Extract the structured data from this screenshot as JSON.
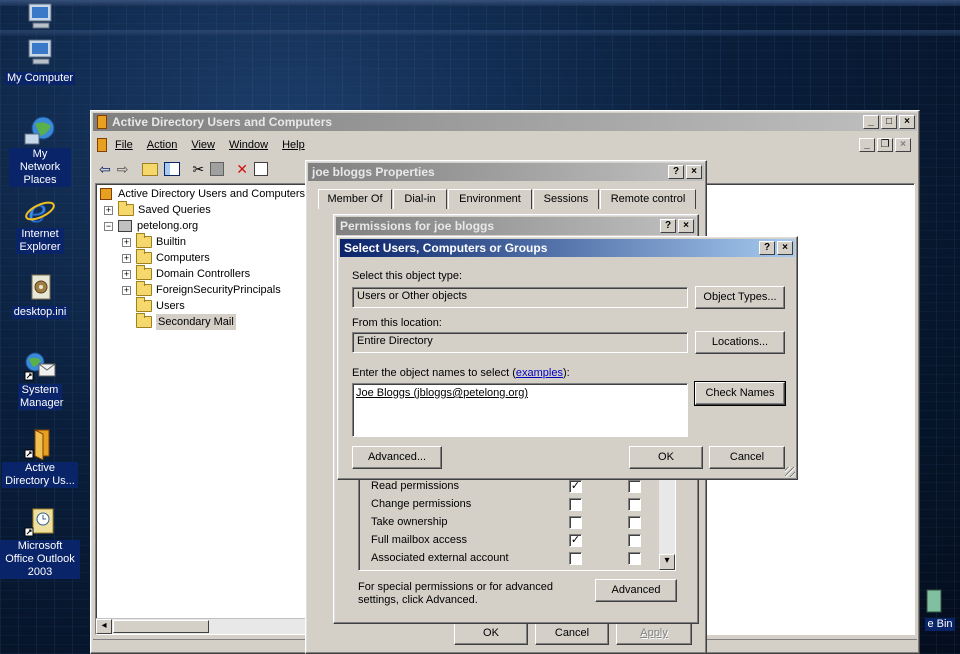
{
  "desktop": {
    "icons": [
      {
        "label": "My Computer"
      },
      {
        "label": "My Network Places"
      },
      {
        "label": "Internet Explorer"
      },
      {
        "label": "desktop.ini"
      },
      {
        "label": "System Manager"
      },
      {
        "label": "Active Directory Us..."
      },
      {
        "label": "Microsoft Office Outlook 2003"
      },
      {
        "label": "e Bin"
      }
    ]
  },
  "aduc": {
    "title": "Active Directory Users and Computers",
    "menu": [
      "File",
      "Action",
      "View",
      "Window",
      "Help"
    ],
    "tree": {
      "root": "Active Directory Users and Computers",
      "items": [
        {
          "label": "Saved Queries"
        },
        {
          "label": "petelong.org"
        },
        {
          "label": "Builtin"
        },
        {
          "label": "Computers"
        },
        {
          "label": "Domain Controllers"
        },
        {
          "label": "ForeignSecurityPrincipals"
        },
        {
          "label": "Users"
        },
        {
          "label": "Secondary Mail"
        }
      ]
    }
  },
  "props": {
    "title": "joe bloggs Properties",
    "tabs": [
      "Member Of",
      "Dial-in",
      "Environment",
      "Sessions",
      "Remote control"
    ],
    "ok": "OK",
    "cancel": "Cancel",
    "apply": "Apply"
  },
  "perms": {
    "title": "Permissions for joe bloggs",
    "rows": [
      {
        "label": "Read permissions",
        "allow": true,
        "deny": false
      },
      {
        "label": "Change permissions",
        "allow": false,
        "deny": false
      },
      {
        "label": "Take ownership",
        "allow": false,
        "deny": false
      },
      {
        "label": "Full mailbox access",
        "allow": true,
        "deny": false
      },
      {
        "label": "Associated external account",
        "allow": false,
        "deny": false
      }
    ],
    "special_text": "For special permissions or for advanced settings, click Advanced.",
    "advanced": "Advanced"
  },
  "select": {
    "title": "Select Users, Computers or Groups",
    "object_type_label": "Select this object type:",
    "object_type_value": "Users or Other objects",
    "object_types_btn": "Object Types...",
    "location_label": "From this location:",
    "location_value": "Entire Directory",
    "locations_btn": "Locations...",
    "names_label": "Enter the object names to select (",
    "names_link": "examples",
    "names_label_end": "):",
    "names_value": "Joe Bloggs (jbloggs@petelong.org)",
    "check_names_btn": "Check Names",
    "advanced_btn": "Advanced...",
    "ok_btn": "OK",
    "cancel_btn": "Cancel"
  }
}
